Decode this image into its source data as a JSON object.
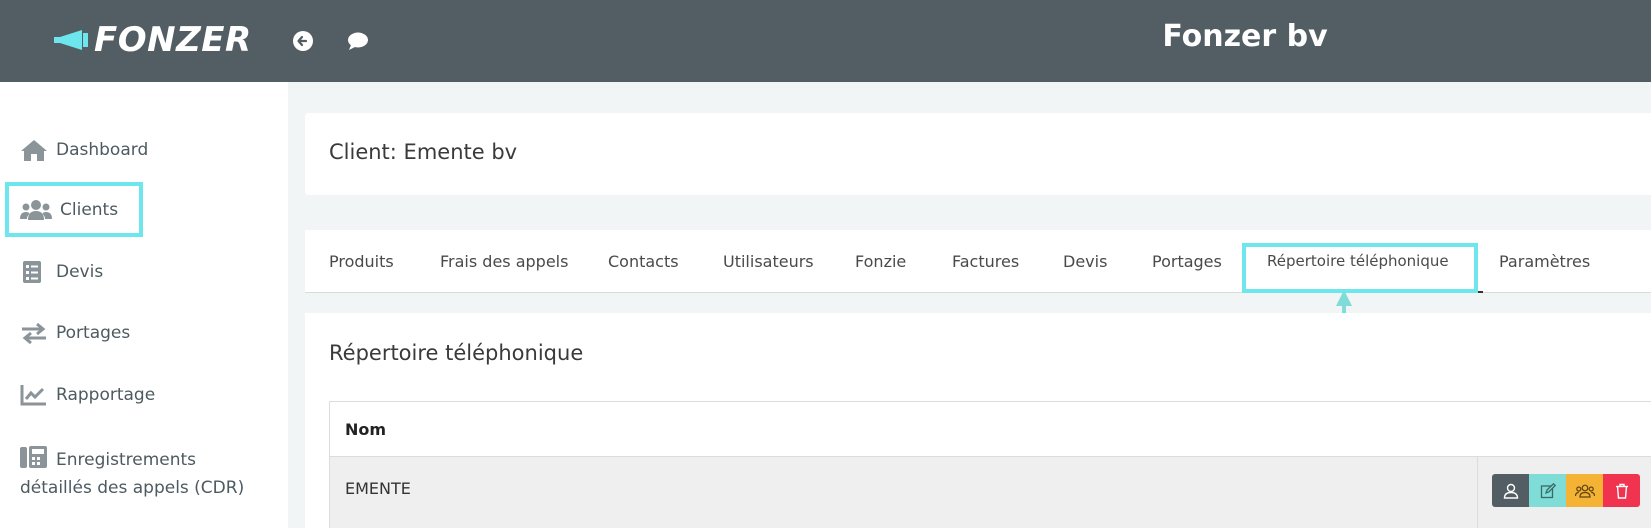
{
  "header": {
    "logo_text": "FONZER",
    "company": "Fonzer bv",
    "icons": [
      "back-arrow-icon",
      "chat-bubble-icon"
    ],
    "bg_color": "#525e64"
  },
  "sidebar": {
    "items": [
      {
        "label": "Dashboard",
        "icon": "home-icon"
      },
      {
        "label": "Clients",
        "icon": "users-icon"
      },
      {
        "label": "Devis",
        "icon": "checklist-icon"
      },
      {
        "label": "Portages",
        "icon": "exchange-icon"
      },
      {
        "label": "Rapportage",
        "icon": "chart-line-icon"
      },
      {
        "label": "Enregistrements détaillés des appels (CDR)",
        "icon": "phone-desk-icon"
      }
    ],
    "highlighted": "Clients",
    "highlight_color": "#6ee6ee"
  },
  "client": {
    "title": "Client: Emente bv"
  },
  "tabs": {
    "items": [
      "Produits",
      "Frais des appels",
      "Contacts",
      "Utilisateurs",
      "Fonzie",
      "Factures",
      "Devis",
      "Portages",
      "Répertoire téléphonique",
      "Paramètres"
    ],
    "active": "Répertoire téléphonique"
  },
  "section": {
    "title": "Répertoire téléphonique",
    "table": {
      "columns": [
        "Nom"
      ],
      "rows": [
        {
          "name": "EMENTE",
          "actions": [
            "user-icon",
            "edit-icon",
            "group-icon",
            "trash-icon"
          ]
        }
      ]
    }
  },
  "action_colors": {
    "user": "#525e64",
    "edit": "#7fdcd6",
    "group": "#f5b335",
    "delete": "#f0334f"
  }
}
